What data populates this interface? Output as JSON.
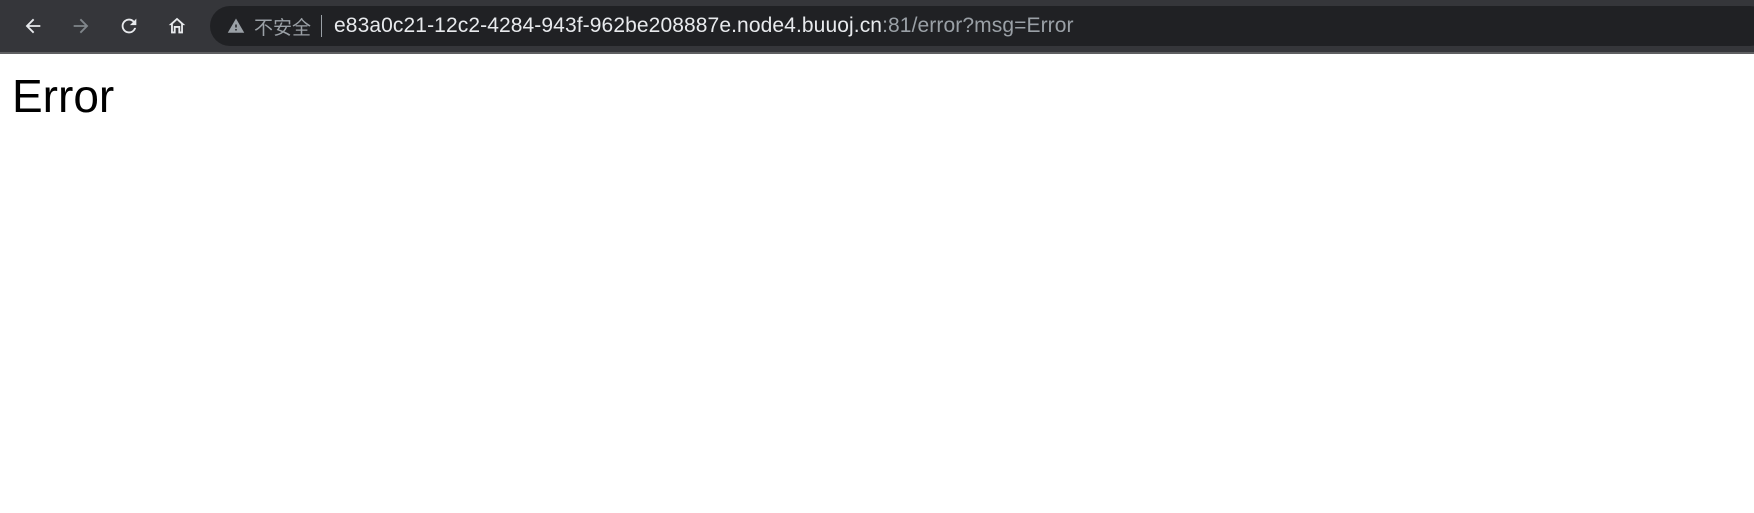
{
  "browser": {
    "toolbar": {
      "back_icon": "arrow-left",
      "forward_icon": "arrow-right",
      "reload_icon": "reload",
      "home_icon": "home"
    },
    "address_bar": {
      "security_icon": "warning-triangle",
      "security_label": "不安全",
      "url_host": "e83a0c21-12c2-4284-943f-962be208887e.node4.buuoj.cn",
      "url_rest": ":81/error?msg=Error"
    },
    "colors": {
      "toolbar_bg": "#35363a",
      "omnibox_bg": "#202124",
      "text_primary": "#e8eaed",
      "text_secondary": "#9aa0a6"
    }
  },
  "page": {
    "heading": "Error"
  }
}
